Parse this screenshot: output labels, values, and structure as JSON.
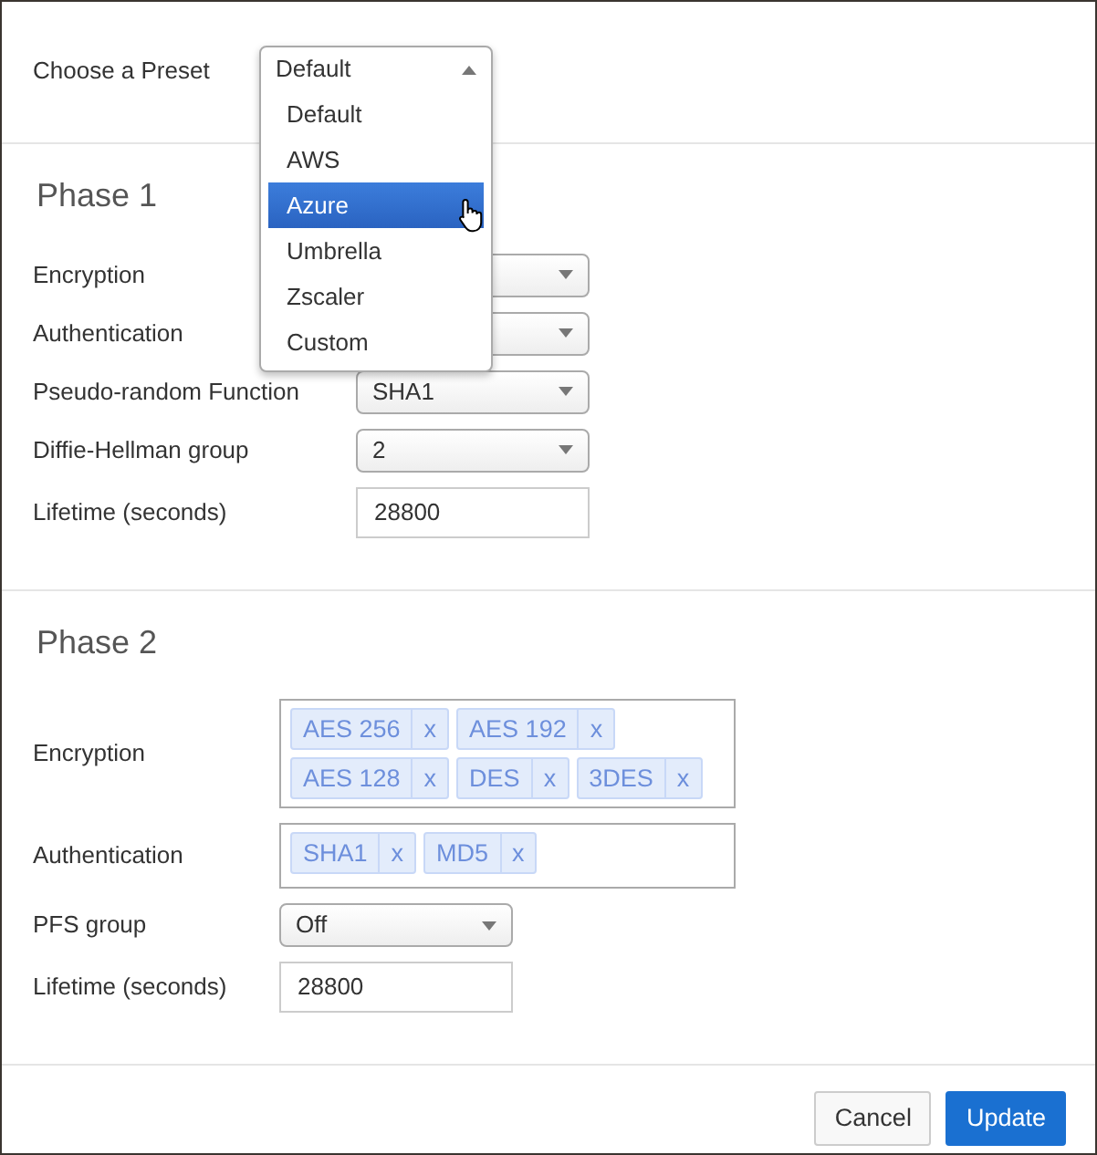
{
  "preset": {
    "label": "Choose a Preset",
    "value": "Default",
    "expanded": true,
    "options": [
      {
        "label": "Default",
        "highlighted": false
      },
      {
        "label": "AWS",
        "highlighted": false
      },
      {
        "label": "Azure",
        "highlighted": true
      },
      {
        "label": "Umbrella",
        "highlighted": false
      },
      {
        "label": "Zscaler",
        "highlighted": false
      },
      {
        "label": "Custom",
        "highlighted": false
      }
    ]
  },
  "sections": [
    {
      "title": "Phase 1",
      "fields": [
        {
          "label": "Encryption",
          "kind": "select"
        },
        {
          "label": "Authentication",
          "kind": "select"
        },
        {
          "label": "Pseudo-random Function",
          "kind": "select",
          "value": "SHA1"
        },
        {
          "label": "Diffie-Hellman group",
          "kind": "select",
          "value": "2"
        },
        {
          "label": "Lifetime (seconds)",
          "kind": "input",
          "value": "28800"
        }
      ]
    },
    {
      "title": "Phase 2",
      "fields": [
        {
          "label": "Encryption",
          "kind": "tags",
          "tags": [
            {
              "label": "AES 256",
              "remove": "x"
            },
            {
              "label": "AES 192",
              "remove": "x"
            },
            {
              "label": "AES 128",
              "remove": "x"
            },
            {
              "label": "DES",
              "remove": "x"
            },
            {
              "label": "3DES",
              "remove": "x"
            }
          ]
        },
        {
          "label": "Authentication",
          "kind": "tags",
          "tags": [
            {
              "label": "SHA1",
              "remove": "x"
            },
            {
              "label": "MD5",
              "remove": "x"
            }
          ]
        },
        {
          "label": "PFS group",
          "kind": "select",
          "value": "Off"
        },
        {
          "label": "Lifetime (seconds)",
          "kind": "input",
          "value": "28800"
        }
      ]
    }
  ],
  "buttons": [
    {
      "label": "Cancel",
      "kind": "secondary"
    },
    {
      "label": "Update",
      "kind": "primary"
    }
  ]
}
